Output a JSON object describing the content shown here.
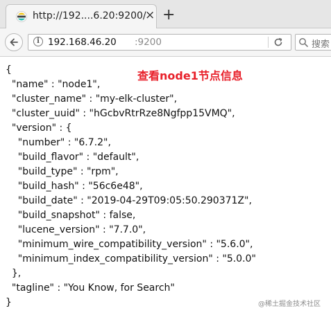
{
  "browser": {
    "tab_title": "http://192....6.20:9200/",
    "tab_close": "×",
    "new_tab": "+",
    "url_host": "192.168.46.20",
    "url_port": ":9200",
    "search_placeholder": "搜索"
  },
  "annotation": "查看node1节点信息",
  "json_lines": [
    "{",
    "  \"name\" : \"node1\",",
    "  \"cluster_name\" : \"my-elk-cluster\",",
    "  \"cluster_uuid\" : \"hGcbvRtrRze8Ngfpp15VMQ\",",
    "  \"version\" : {",
    "    \"number\" : \"6.7.2\",",
    "    \"build_flavor\" : \"default\",",
    "    \"build_type\" : \"rpm\",",
    "    \"build_hash\" : \"56c6e48\",",
    "    \"build_date\" : \"2019-04-29T09:05:50.290371Z\",",
    "    \"build_snapshot\" : false,",
    "    \"lucene_version\" : \"7.7.0\",",
    "    \"minimum_wire_compatibility_version\" : \"5.6.0\",",
    "    \"minimum_index_compatibility_version\" : \"5.0.0\"",
    "  },",
    "  \"tagline\" : \"You Know, for Search\"",
    "}"
  ],
  "watermark": "@稀土掘金技术社区",
  "colors": {
    "annotation": "#e8202a",
    "url_port": "#8a8a8a"
  }
}
